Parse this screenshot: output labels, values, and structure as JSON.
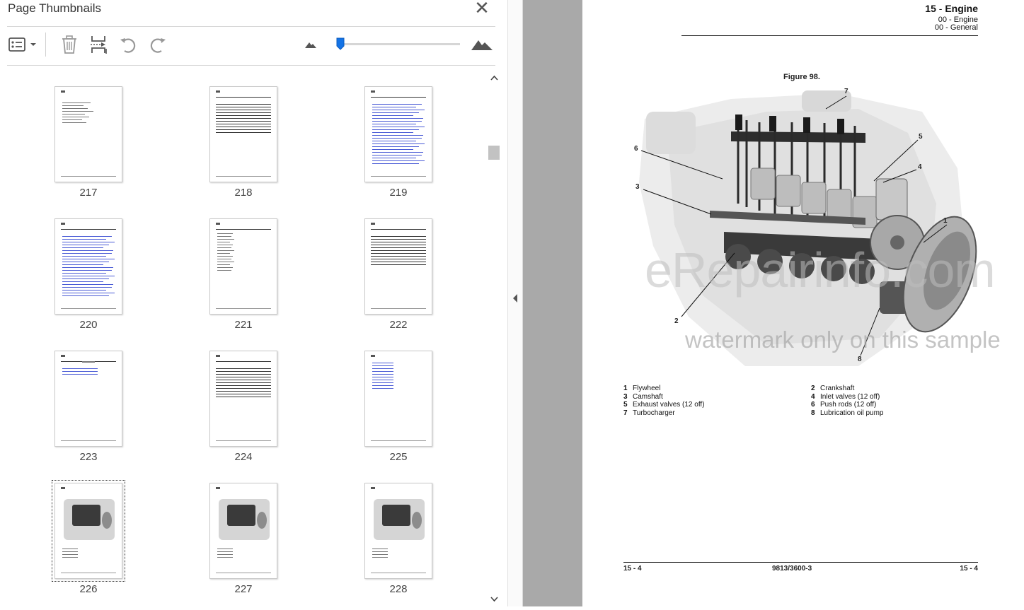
{
  "panel": {
    "title": "Page Thumbnails",
    "close_label": "✕",
    "toolbar": {
      "options_icon": "thumbnail-options-icon",
      "delete_icon": "trash-icon",
      "insert_icon": "insert-pages-icon",
      "rotate_ccw_icon": "rotate-counterclockwise-icon",
      "rotate_cw_icon": "rotate-clockwise-icon",
      "zoom_out_icon": "small-mountain-icon",
      "zoom_in_icon": "large-mountain-icon",
      "zoom_slider_fraction": 0.03
    },
    "thumbnails": [
      {
        "page": "217",
        "kind": "text"
      },
      {
        "page": "218",
        "kind": "lines"
      },
      {
        "page": "219",
        "kind": "toc"
      },
      {
        "page": "220",
        "kind": "toc2"
      },
      {
        "page": "221",
        "kind": "list"
      },
      {
        "page": "222",
        "kind": "lines"
      },
      {
        "page": "223",
        "kind": "title"
      },
      {
        "page": "224",
        "kind": "lines"
      },
      {
        "page": "225",
        "kind": "twocol"
      },
      {
        "page": "226",
        "kind": "figure",
        "selected": true
      },
      {
        "page": "227",
        "kind": "figure"
      },
      {
        "page": "228",
        "kind": "figure"
      }
    ]
  },
  "document": {
    "header": {
      "chapter_num": "15",
      "chapter_sep": " - ",
      "chapter_name": "Engine",
      "sub1": "00 - Engine",
      "sub2": "00 - General"
    },
    "figure_label": "Figure 98.",
    "callouts": [
      "7",
      "6",
      "5",
      "4",
      "3",
      "1",
      "2",
      "8"
    ],
    "legend": [
      {
        "num": "1",
        "text": "Flywheel"
      },
      {
        "num": "2",
        "text": "Crankshaft"
      },
      {
        "num": "3",
        "text": "Camshaft"
      },
      {
        "num": "4",
        "text": "Inlet valves (12 off)"
      },
      {
        "num": "5",
        "text": "Exhaust valves (12 off)"
      },
      {
        "num": "6",
        "text": "Push rods (12 off)"
      },
      {
        "num": "7",
        "text": "Turbocharger"
      },
      {
        "num": "8",
        "text": "Lubrication oil pump"
      }
    ],
    "footer": {
      "left": "15 - 4",
      "center": "9813/3600-3",
      "right": "15 - 4"
    },
    "watermark_main": "eRepairinfo.com",
    "watermark_sub": "watermark only on this sample"
  },
  "colors": {
    "accent": "#1473e6",
    "viewer_bg": "#a9a9a9"
  }
}
